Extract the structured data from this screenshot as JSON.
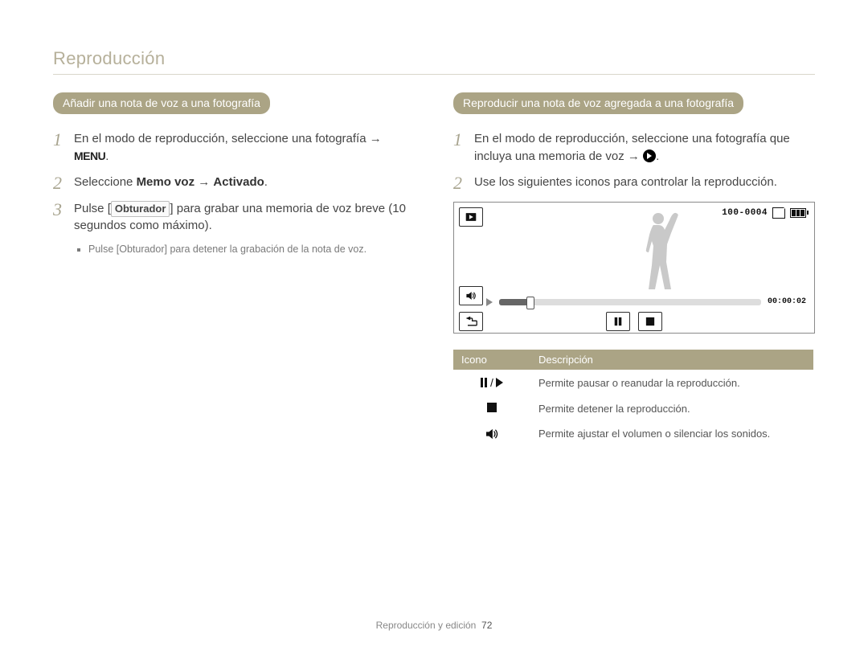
{
  "section_title": "Reproducción",
  "left": {
    "pill": "Añadir una nota de voz a una fotografía",
    "step1": "En el modo de reproducción, seleccione una fotografía →",
    "step1_menu": "MENU",
    "step1_suffix": ".",
    "step2_a": "Seleccione ",
    "step2_b": "Memo voz",
    "step2_c": " → ",
    "step2_d": "Activado",
    "step2_e": ".",
    "step3_a": "Pulse [",
    "step3_btn": "Obturador",
    "step3_b": "] para grabar una memoria de voz breve (10 segundos como máximo).",
    "sub_a": "Pulse [",
    "sub_btn": "Obturador",
    "sub_b": "] para detener la grabación de la nota de voz."
  },
  "right": {
    "pill": "Reproducir una nota de voz agregada a una fotografía",
    "step1": "En el modo de reproducción, seleccione una fotografía que incluya una memoria de voz → ",
    "step1_suffix": ".",
    "step2": "Use los siguientes iconos para controlar la reproducción.",
    "lcd": {
      "file_counter": "100-0004",
      "time": "00:00:02"
    },
    "table": {
      "h_icon": "Icono",
      "h_desc": "Descripción",
      "r1": "Permite pausar o reanudar la reproducción.",
      "r2": "Permite detener la reproducción.",
      "r3": "Permite ajustar el volumen o silenciar los sonidos."
    }
  },
  "footer": {
    "section": "Reproducción y edición",
    "page": "72"
  }
}
